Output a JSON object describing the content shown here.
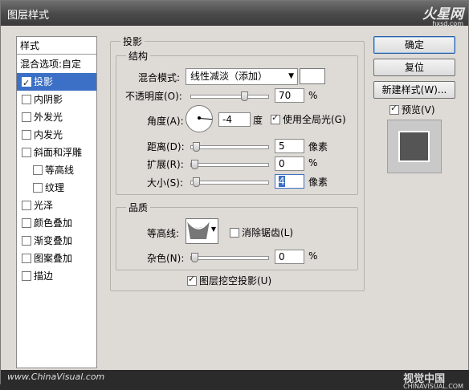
{
  "window": {
    "title": "图层样式"
  },
  "watermark_top": {
    "logo": "火星网",
    "url": "hxsd.com"
  },
  "watermark_bottom": {
    "left": "www.ChinaVisual.com",
    "right": "视觉中国",
    "right_sub": "CHINAVISUAL.COM"
  },
  "sidebar": {
    "header": "样式",
    "items": [
      {
        "label": "混合选项:自定",
        "checkbox": false
      },
      {
        "label": "投影",
        "checkbox": true,
        "checked": true,
        "selected": true
      },
      {
        "label": "内阴影",
        "checkbox": true
      },
      {
        "label": "外发光",
        "checkbox": true
      },
      {
        "label": "内发光",
        "checkbox": true
      },
      {
        "label": "斜面和浮雕",
        "checkbox": true
      },
      {
        "label": "等高线",
        "checkbox": true
      },
      {
        "label": "纹理",
        "checkbox": true
      },
      {
        "label": "光泽",
        "checkbox": true
      },
      {
        "label": "颜色叠加",
        "checkbox": true
      },
      {
        "label": "渐变叠加",
        "checkbox": true
      },
      {
        "label": "图案叠加",
        "checkbox": true
      },
      {
        "label": "描边",
        "checkbox": true
      }
    ]
  },
  "panel": {
    "title": "投影",
    "structure": {
      "label": "结构",
      "blend_mode_label": "混合模式:",
      "blend_mode_value": "线性减淡（添加）",
      "blend_color": "#ffffff",
      "opacity_label": "不透明度(O):",
      "opacity_value": "70",
      "opacity_unit": "%",
      "opacity_slider": 0.7,
      "angle_label": "角度(A):",
      "angle_value": "-4",
      "angle_unit": "度",
      "global_light_label": "使用全局光(G)",
      "global_light_checked": true,
      "distance_label": "距离(D):",
      "distance_value": "5",
      "distance_unit": "像素",
      "distance_slider": 0.02,
      "spread_label": "扩展(R):",
      "spread_value": "0",
      "spread_unit": "%",
      "spread_slider": 0.0,
      "size_label": "大小(S):",
      "size_value": "4",
      "size_unit": "像素",
      "size_slider": 0.02
    },
    "quality": {
      "label": "品质",
      "contour_label": "等高线:",
      "antialias_label": "消除锯齿(L)",
      "antialias_checked": false,
      "noise_label": "杂色(N):",
      "noise_value": "0",
      "noise_unit": "%",
      "noise_slider": 0.0
    },
    "knockout_label": "图层挖空投影(U)",
    "knockout_checked": true
  },
  "buttons": {
    "ok": "确定",
    "reset": "复位",
    "new_style": "新建样式(W)...",
    "preview_label": "预览(V)",
    "preview_checked": true
  }
}
